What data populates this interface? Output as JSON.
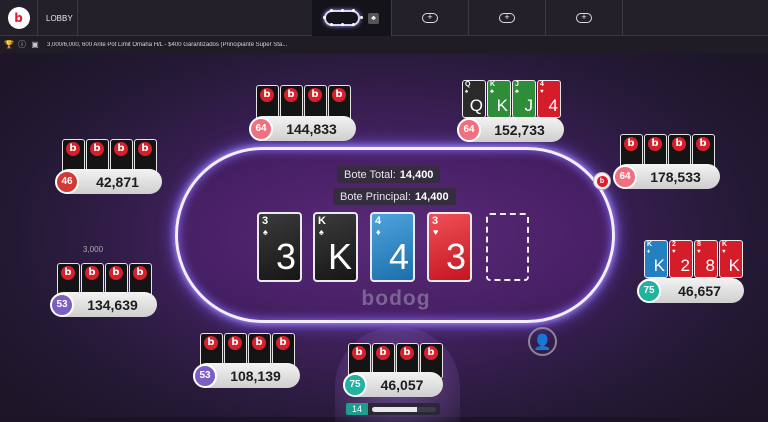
{
  "topbar": {
    "logo_text": "b",
    "lobby_label": "LOBBY",
    "add_tab_glyph": "+"
  },
  "infobar": {
    "icons": [
      "trophy-icon",
      "info-icon",
      "cashier-icon"
    ],
    "game_name": "3,000/6,000, 600 Ante Pot Limit Omaha H/L - $400 Garantizados (Principiante Super Sta..."
  },
  "table": {
    "pot_total_label": "Bote Total:",
    "pot_total_value": "14,400",
    "pot_main_label": "Bote Principal:",
    "pot_main_value": "14,400",
    "brand": "bodog",
    "board": [
      {
        "rank": "3",
        "suit": "♠",
        "color": "black"
      },
      {
        "rank": "K",
        "suit": "♠",
        "color": "black"
      },
      {
        "rank": "4",
        "suit": "♦",
        "color": "blue"
      },
      {
        "rank": "3",
        "suit": "♥",
        "color": "red"
      }
    ]
  },
  "players": [
    {
      "id": "top-left",
      "level": "64",
      "chips": "144,833"
    },
    {
      "id": "top-center",
      "level": "64",
      "chips": "152,733",
      "cards": [
        {
          "rank": "Q",
          "suit": "♠",
          "color": "black"
        },
        {
          "rank": "K",
          "suit": "♣",
          "color": "green"
        },
        {
          "rank": "J",
          "suit": "♣",
          "color": "green"
        },
        {
          "rank": "4",
          "suit": "♥",
          "color": "red"
        }
      ]
    },
    {
      "id": "right-top",
      "level": "64",
      "chips": "178,533"
    },
    {
      "id": "left-top",
      "level": "46",
      "chips": "42,871"
    },
    {
      "id": "left-mid",
      "level": "53",
      "chips": "134,639",
      "ghost": "3,000"
    },
    {
      "id": "right-mid",
      "level": "75",
      "chips": "46,657",
      "cards": [
        {
          "rank": "K",
          "suit": "♦",
          "color": "blue"
        },
        {
          "rank": "2",
          "suit": "♥",
          "color": "red"
        },
        {
          "rank": "8",
          "suit": "♥",
          "color": "red"
        },
        {
          "rank": "K",
          "suit": "♥",
          "color": "red"
        }
      ]
    },
    {
      "id": "bottom-left",
      "level": "53",
      "chips": "108,139"
    },
    {
      "id": "hero",
      "level": "75",
      "chips": "46,057"
    }
  ],
  "timer": {
    "seconds": "14",
    "progress": 0.7
  },
  "colors": {
    "rail": "#f2eeff",
    "accent_red": "#d8202c",
    "teal": "#1fb3a0",
    "purple": "#7d5fc4",
    "pink": "#f0707f"
  }
}
